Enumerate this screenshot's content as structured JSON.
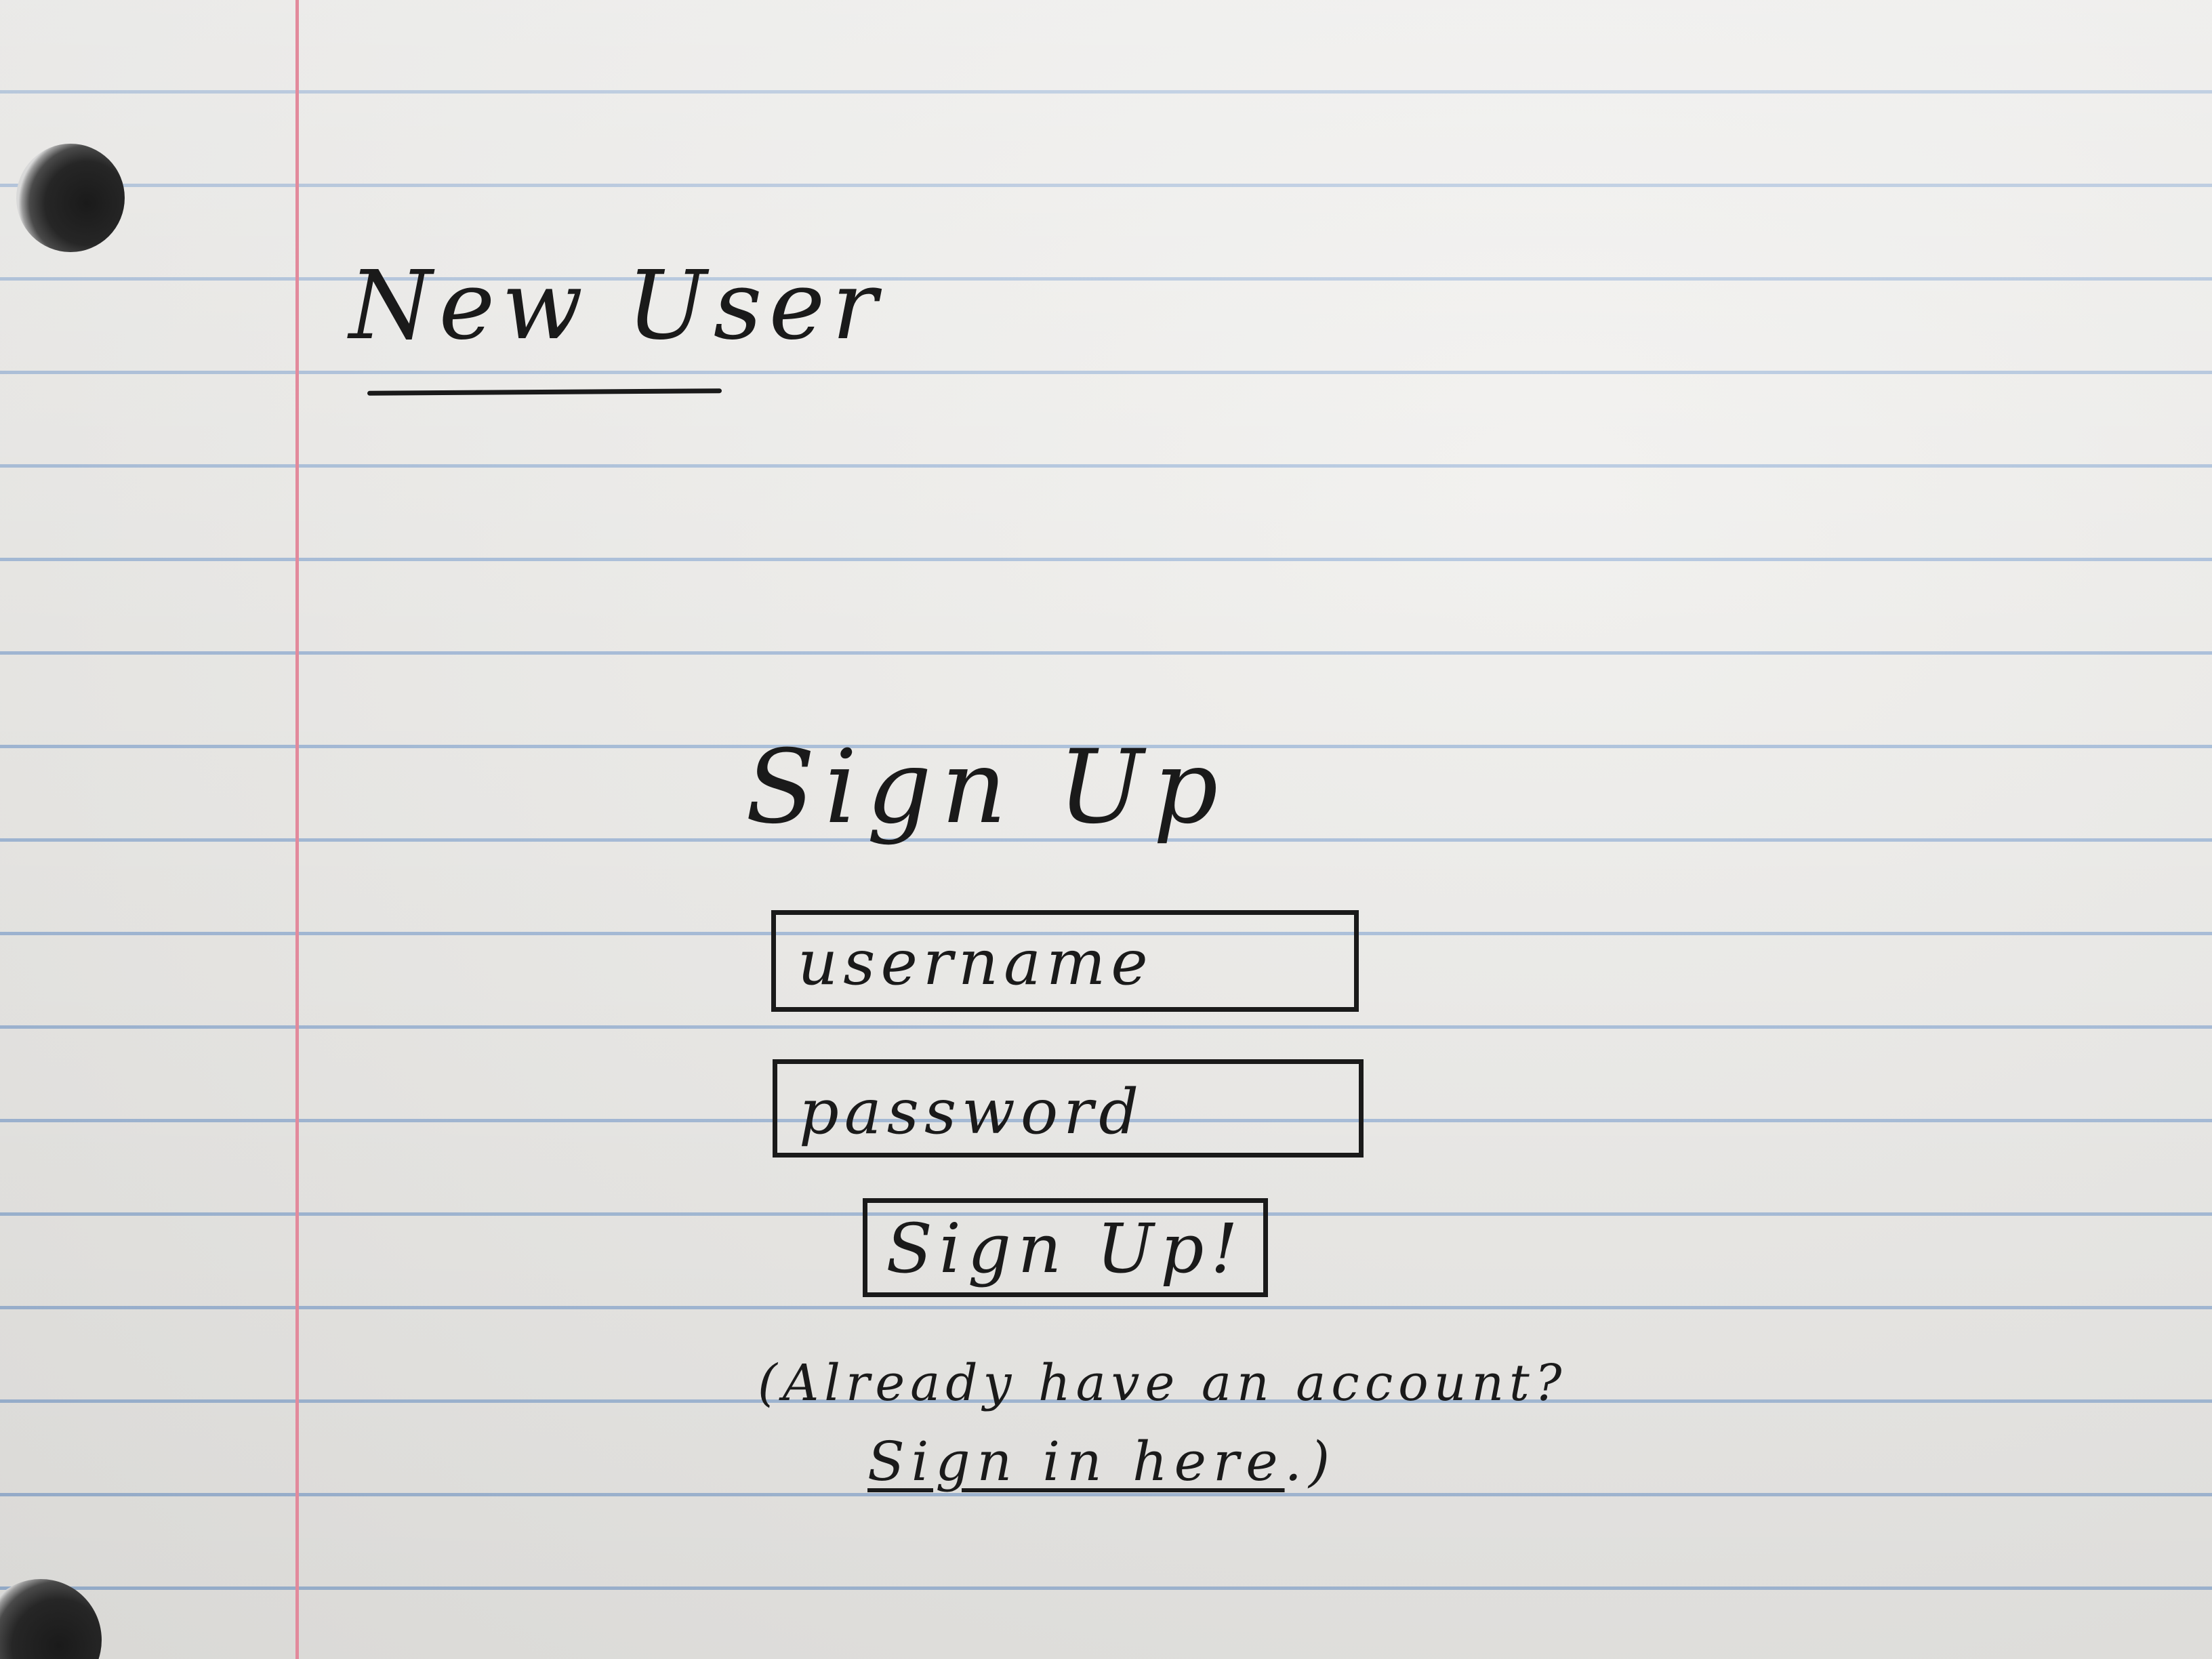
{
  "page": {
    "title": "New User"
  },
  "form": {
    "heading": "Sign Up",
    "username": {
      "placeholder": "username",
      "value": ""
    },
    "password": {
      "placeholder": "password",
      "value": ""
    },
    "submit_label": "Sign Up!"
  },
  "signin_prompt": {
    "question": "(Already have an account?",
    "link_label": "Sign in here",
    "suffix": ".)"
  },
  "colors": {
    "paper": "#ecebe8",
    "rule_lines": "#9db6d6",
    "margin_line": "#e28a9c",
    "ink": "#1a1a1a"
  }
}
